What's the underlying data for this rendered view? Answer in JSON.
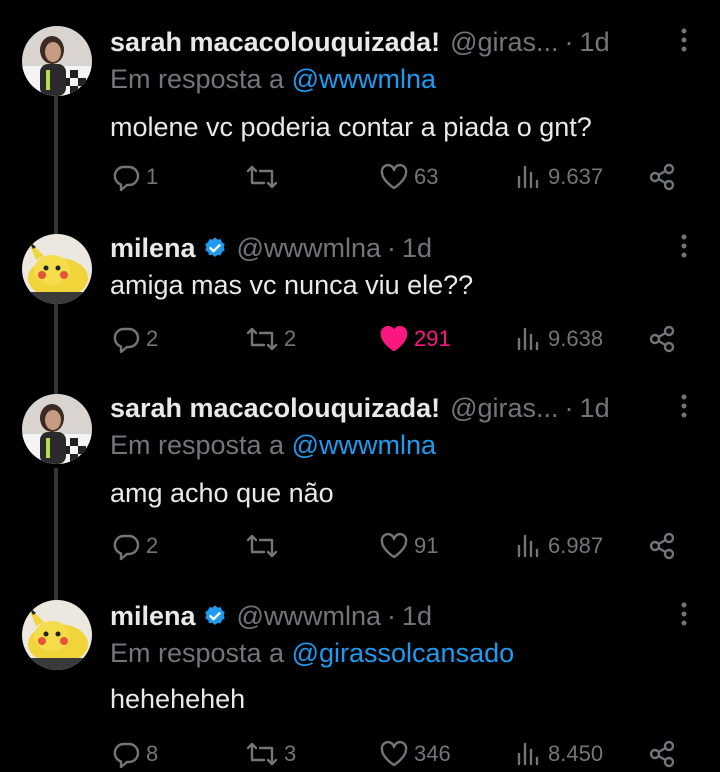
{
  "tweets": [
    {
      "name": "sarah macacolouquizada!",
      "handle": "@giras...",
      "dot": "·",
      "time": "1d",
      "verified": false,
      "avatar": "girl-photo-avatar",
      "reply_prefix": "Em resposta a",
      "reply_to": "@wwwmlna",
      "text": "molene vc poderia contar a piada o gnt?",
      "replies": "1",
      "retweets": "",
      "likes": "63",
      "liked": false,
      "views": "9.637"
    },
    {
      "name": "milena",
      "handle": "@wwwmlna",
      "dot": "·",
      "time": "1d",
      "verified": true,
      "avatar": "pikachu-plush-avatar",
      "reply_prefix": "",
      "reply_to": "",
      "text": "amiga mas vc nunca viu ele??",
      "replies": "2",
      "retweets": "2",
      "likes": "291",
      "liked": true,
      "views": "9.638"
    },
    {
      "name": "sarah macacolouquizada!",
      "handle": "@giras...",
      "dot": "·",
      "time": "1d",
      "verified": false,
      "avatar": "girl-photo-avatar",
      "reply_prefix": "Em resposta a",
      "reply_to": "@wwwmlna",
      "text": "amg acho que não",
      "replies": "2",
      "retweets": "",
      "likes": "91",
      "liked": false,
      "views": "6.987"
    },
    {
      "name": "milena",
      "handle": "@wwwmlna",
      "dot": "·",
      "time": "1d",
      "verified": true,
      "avatar": "pikachu-plush-avatar",
      "reply_prefix": "Em resposta a",
      "reply_to": "@girassolcansado",
      "text": "heheheheh",
      "replies": "8",
      "retweets": "3",
      "likes": "346",
      "liked": false,
      "views": "8.450"
    }
  ],
  "colors": {
    "background": "#000000",
    "text": "#e7e9ea",
    "muted": "#71767b",
    "link": "#1d9bf0",
    "like": "#f91880",
    "verified": "#1d9bf0"
  }
}
